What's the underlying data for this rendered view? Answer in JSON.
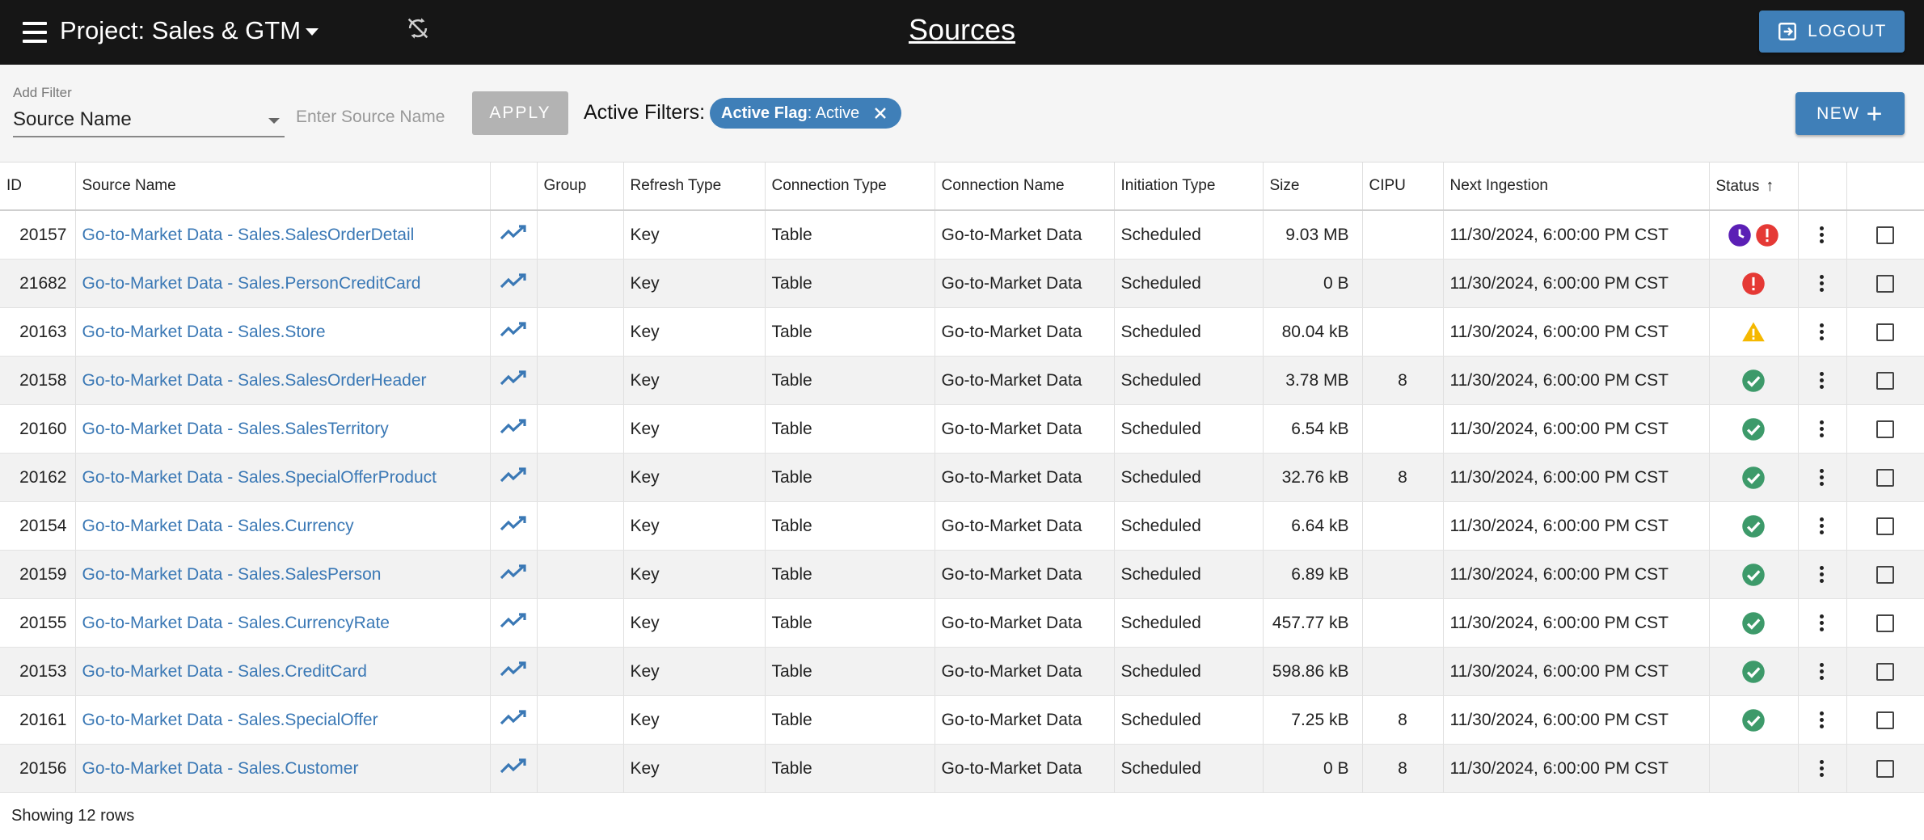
{
  "header": {
    "project_label": "Project:",
    "project_name": "Sales & GTM",
    "page_title": "Sources",
    "logout_label": "LOGOUT"
  },
  "filter": {
    "add_filter_label": "Add Filter",
    "selected_field": "Source Name",
    "input_placeholder": "Enter Source Name",
    "apply_label": "APPLY",
    "active_filters_label": "Active Filters:",
    "chip_key": "Active Flag",
    "chip_value": ": Active",
    "new_label": "NEW"
  },
  "table": {
    "columns": {
      "id": "ID",
      "source_name": "Source Name",
      "group": "Group",
      "refresh_type": "Refresh Type",
      "connection_type": "Connection Type",
      "connection_name": "Connection Name",
      "initiation_type": "Initiation Type",
      "size": "Size",
      "cipu": "CIPU",
      "next_ingestion": "Next Ingestion",
      "status": "Status"
    },
    "rows": [
      {
        "id": "20157",
        "name": "Go-to-Market Data - Sales.SalesOrderDetail",
        "group": "",
        "refresh": "Key",
        "conn_type": "Table",
        "conn_name": "Go-to-Market Data",
        "init": "Scheduled",
        "size": "9.03 MB",
        "cipu": "",
        "next": "11/30/2024, 6:00:00 PM CST",
        "status": [
          "clock",
          "error"
        ]
      },
      {
        "id": "21682",
        "name": "Go-to-Market Data - Sales.PersonCreditCard",
        "group": "",
        "refresh": "Key",
        "conn_type": "Table",
        "conn_name": "Go-to-Market Data",
        "init": "Scheduled",
        "size": "0 B",
        "cipu": "",
        "next": "11/30/2024, 6:00:00 PM CST",
        "status": [
          "error"
        ]
      },
      {
        "id": "20163",
        "name": "Go-to-Market Data - Sales.Store",
        "group": "",
        "refresh": "Key",
        "conn_type": "Table",
        "conn_name": "Go-to-Market Data",
        "init": "Scheduled",
        "size": "80.04 kB",
        "cipu": "",
        "next": "11/30/2024, 6:00:00 PM CST",
        "status": [
          "warning"
        ]
      },
      {
        "id": "20158",
        "name": "Go-to-Market Data - Sales.SalesOrderHeader",
        "group": "",
        "refresh": "Key",
        "conn_type": "Table",
        "conn_name": "Go-to-Market Data",
        "init": "Scheduled",
        "size": "3.78 MB",
        "cipu": "8",
        "next": "11/30/2024, 6:00:00 PM CST",
        "status": [
          "success"
        ]
      },
      {
        "id": "20160",
        "name": "Go-to-Market Data - Sales.SalesTerritory",
        "group": "",
        "refresh": "Key",
        "conn_type": "Table",
        "conn_name": "Go-to-Market Data",
        "init": "Scheduled",
        "size": "6.54 kB",
        "cipu": "",
        "next": "11/30/2024, 6:00:00 PM CST",
        "status": [
          "success"
        ]
      },
      {
        "id": "20162",
        "name": "Go-to-Market Data - Sales.SpecialOfferProduct",
        "group": "",
        "refresh": "Key",
        "conn_type": "Table",
        "conn_name": "Go-to-Market Data",
        "init": "Scheduled",
        "size": "32.76 kB",
        "cipu": "8",
        "next": "11/30/2024, 6:00:00 PM CST",
        "status": [
          "success"
        ]
      },
      {
        "id": "20154",
        "name": "Go-to-Market Data - Sales.Currency",
        "group": "",
        "refresh": "Key",
        "conn_type": "Table",
        "conn_name": "Go-to-Market Data",
        "init": "Scheduled",
        "size": "6.64 kB",
        "cipu": "",
        "next": "11/30/2024, 6:00:00 PM CST",
        "status": [
          "success"
        ]
      },
      {
        "id": "20159",
        "name": "Go-to-Market Data - Sales.SalesPerson",
        "group": "",
        "refresh": "Key",
        "conn_type": "Table",
        "conn_name": "Go-to-Market Data",
        "init": "Scheduled",
        "size": "6.89 kB",
        "cipu": "",
        "next": "11/30/2024, 6:00:00 PM CST",
        "status": [
          "success"
        ]
      },
      {
        "id": "20155",
        "name": "Go-to-Market Data - Sales.CurrencyRate",
        "group": "",
        "refresh": "Key",
        "conn_type": "Table",
        "conn_name": "Go-to-Market Data",
        "init": "Scheduled",
        "size": "457.77 kB",
        "cipu": "",
        "next": "11/30/2024, 6:00:00 PM CST",
        "status": [
          "success"
        ]
      },
      {
        "id": "20153",
        "name": "Go-to-Market Data - Sales.CreditCard",
        "group": "",
        "refresh": "Key",
        "conn_type": "Table",
        "conn_name": "Go-to-Market Data",
        "init": "Scheduled",
        "size": "598.86 kB",
        "cipu": "",
        "next": "11/30/2024, 6:00:00 PM CST",
        "status": [
          "success"
        ]
      },
      {
        "id": "20161",
        "name": "Go-to-Market Data - Sales.SpecialOffer",
        "group": "",
        "refresh": "Key",
        "conn_type": "Table",
        "conn_name": "Go-to-Market Data",
        "init": "Scheduled",
        "size": "7.25 kB",
        "cipu": "8",
        "next": "11/30/2024, 6:00:00 PM CST",
        "status": [
          "success"
        ]
      },
      {
        "id": "20156",
        "name": "Go-to-Market Data - Sales.Customer",
        "group": "",
        "refresh": "Key",
        "conn_type": "Table",
        "conn_name": "Go-to-Market Data",
        "init": "Scheduled",
        "size": "0 B",
        "cipu": "8",
        "next": "11/30/2024, 6:00:00 PM CST",
        "status": []
      }
    ]
  },
  "footer": {
    "row_count_text": "Showing 12 rows"
  },
  "colors": {
    "accent": "#3f7fb8",
    "link": "#3a78b5",
    "success": "#3d9a6a",
    "error": "#e53935",
    "warning": "#f5b800",
    "scheduled": "#5b1fb5"
  },
  "icons": {
    "menu": "menu-icon",
    "sync_disabled": "sync-disabled-icon",
    "logout": "logout-icon",
    "close": "close-icon",
    "add": "plus-icon",
    "trend": "trending-up-icon",
    "sort": "arrow-up-icon",
    "more": "more-vertical-icon"
  }
}
